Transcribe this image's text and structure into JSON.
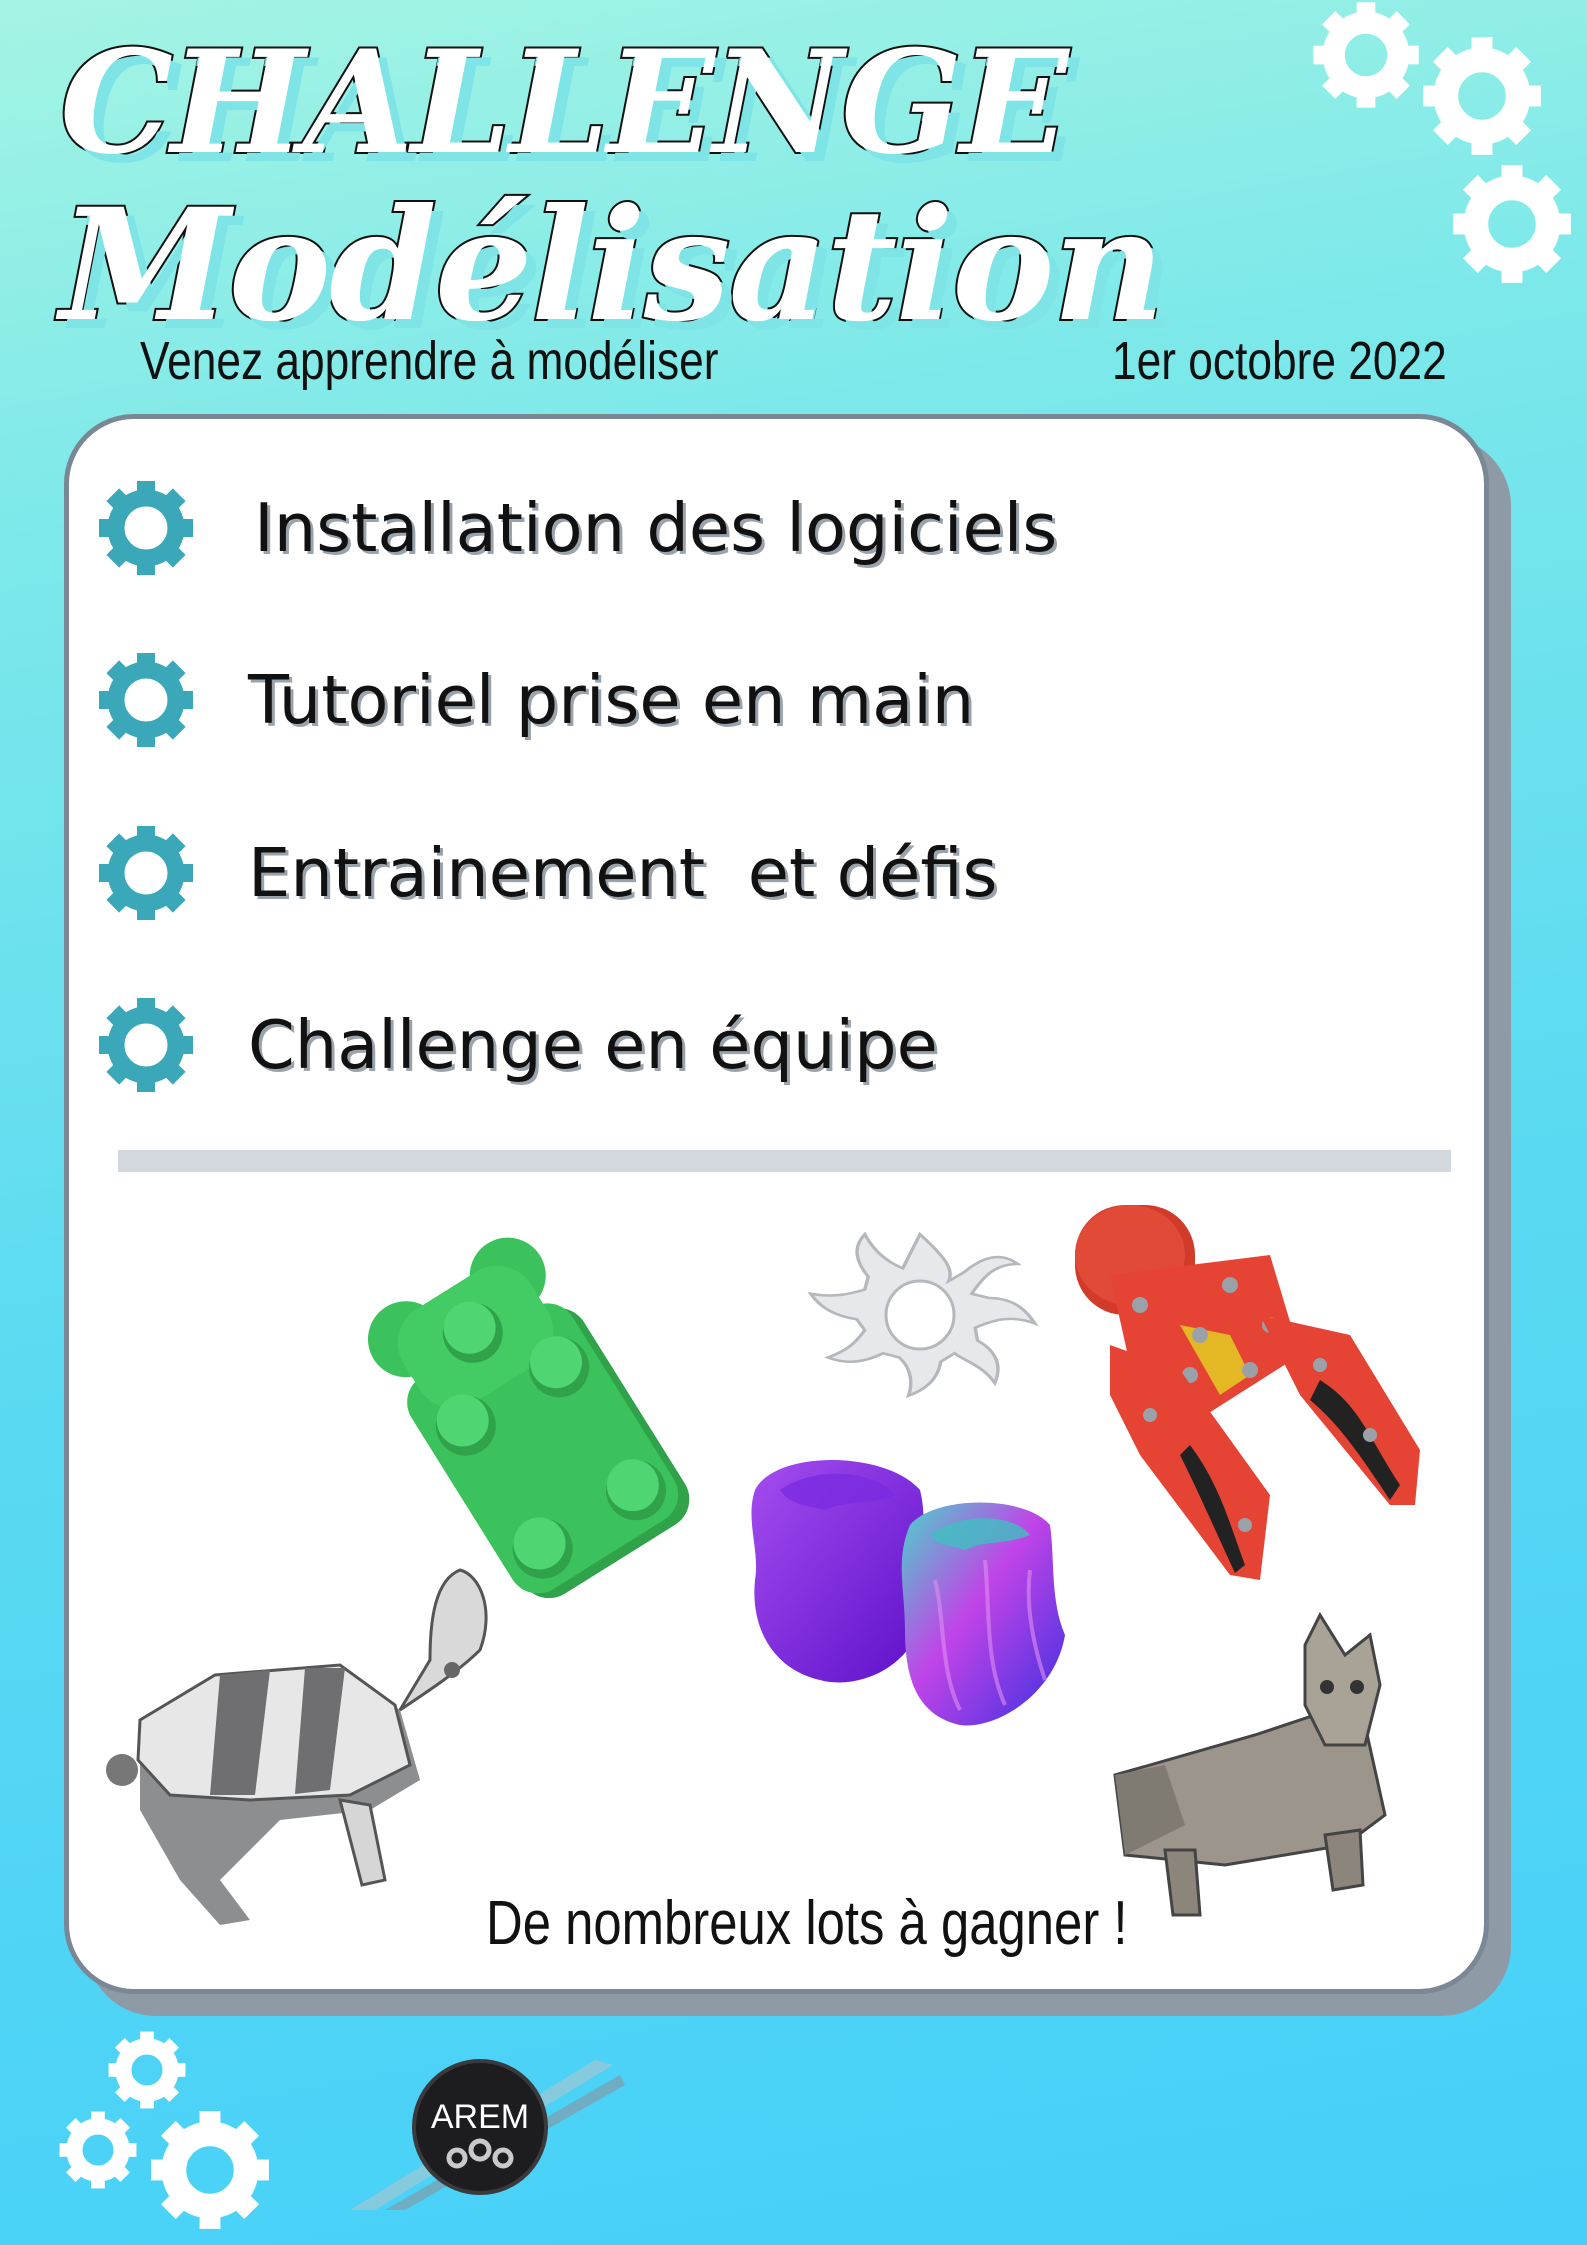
{
  "title": {
    "line1": "CHALLENGE",
    "line2": "Modélisation"
  },
  "subtitle": {
    "left": "Venez apprendre à modéliser",
    "right": "1er octobre 2022"
  },
  "items": [
    {
      "label": "Installation des logiciels",
      "icon": "gear-icon"
    },
    {
      "label": "Tutoriel prise en main",
      "icon": "gear-icon"
    },
    {
      "label": "Entrainement  et défis",
      "icon": "gear-icon"
    },
    {
      "label": "Challenge en équipe",
      "icon": "gear-icon"
    }
  ],
  "prizes": "De nombreux lots à gagner !",
  "logo": {
    "text": "AREM"
  },
  "colors": {
    "background_top": "#a4f4e3",
    "background_bottom": "#45cff9",
    "gear_teal": "#3aa8b8",
    "card_border": "#7a8794",
    "divider": "#d3d8de"
  },
  "images": [
    "green-bear-model",
    "sun-shape-model",
    "red-robot-gripper-model",
    "purple-rose-models",
    "rabbit-model",
    "corgi-dog-model"
  ]
}
